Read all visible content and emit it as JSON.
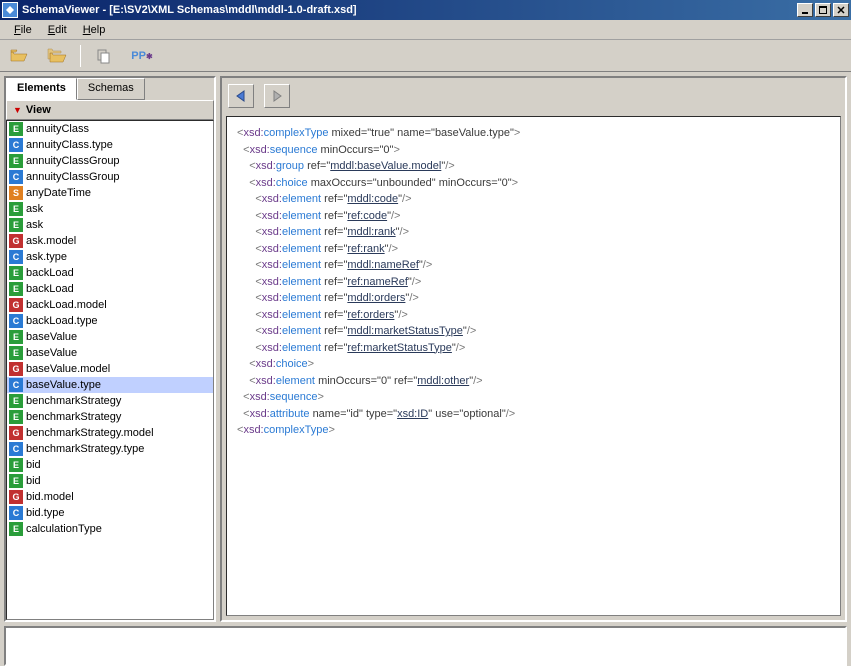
{
  "title": "SchemaViewer - [E:\\SV2\\XML Schemas\\mddl\\mddl-1.0-draft.xsd]",
  "menu": {
    "file": "File",
    "edit": "Edit",
    "help": "Help"
  },
  "tabs": {
    "elements": "Elements",
    "schemas": "Schemas"
  },
  "view_label": "View",
  "tree": [
    {
      "badge": "E",
      "label": "annuityClass"
    },
    {
      "badge": "C",
      "label": "annuityClass.type"
    },
    {
      "badge": "E",
      "label": "annuityClassGroup"
    },
    {
      "badge": "C",
      "label": "annuityClassGroup"
    },
    {
      "badge": "S",
      "label": "anyDateTime"
    },
    {
      "badge": "E",
      "label": "ask"
    },
    {
      "badge": "E",
      "label": "ask"
    },
    {
      "badge": "G",
      "label": "ask.model"
    },
    {
      "badge": "C",
      "label": "ask.type"
    },
    {
      "badge": "E",
      "label": "backLoad"
    },
    {
      "badge": "E",
      "label": "backLoad"
    },
    {
      "badge": "G",
      "label": "backLoad.model"
    },
    {
      "badge": "C",
      "label": "backLoad.type"
    },
    {
      "badge": "E",
      "label": "baseValue"
    },
    {
      "badge": "E",
      "label": "baseValue"
    },
    {
      "badge": "G",
      "label": "baseValue.model"
    },
    {
      "badge": "C",
      "label": "baseValue.type",
      "selected": true
    },
    {
      "badge": "E",
      "label": "benchmarkStrategy"
    },
    {
      "badge": "E",
      "label": "benchmarkStrategy"
    },
    {
      "badge": "G",
      "label": "benchmarkStrategy.model"
    },
    {
      "badge": "C",
      "label": "benchmarkStrategy.type"
    },
    {
      "badge": "E",
      "label": "bid"
    },
    {
      "badge": "E",
      "label": "bid"
    },
    {
      "badge": "G",
      "label": "bid.model"
    },
    {
      "badge": "C",
      "label": "bid.type"
    },
    {
      "badge": "E",
      "label": "calculationType"
    }
  ],
  "code": [
    {
      "indent": 0,
      "type": "open",
      "pfx": "xsd:",
      "tag": "complexType",
      "attrs": [
        [
          "mixed",
          "\"true\""
        ],
        [
          "name",
          "\"baseValue.type\""
        ]
      ]
    },
    {
      "indent": 1,
      "type": "open",
      "pfx": "xsd:",
      "tag": "sequence",
      "attrs": [
        [
          "minOccurs",
          "\"0\""
        ]
      ]
    },
    {
      "indent": 2,
      "type": "self",
      "pfx": "xsd:",
      "tag": "group",
      "attrs": [
        [
          "ref",
          "\"mddl:baseValue.model\"",
          "ref"
        ]
      ]
    },
    {
      "indent": 2,
      "type": "open",
      "pfx": "xsd:",
      "tag": "choice",
      "attrs": [
        [
          "maxOccurs",
          "\"unbounded\""
        ],
        [
          "minOccurs",
          "\"0\""
        ]
      ]
    },
    {
      "indent": 3,
      "type": "self",
      "pfx": "xsd:",
      "tag": "element",
      "attrs": [
        [
          "ref",
          "\"mddl:code\"",
          "ref"
        ]
      ]
    },
    {
      "indent": 3,
      "type": "self",
      "pfx": "xsd:",
      "tag": "element",
      "attrs": [
        [
          "ref",
          "\"ref:code\"",
          "ref"
        ]
      ]
    },
    {
      "indent": 3,
      "type": "self",
      "pfx": "xsd:",
      "tag": "element",
      "attrs": [
        [
          "ref",
          "\"mddl:rank\"",
          "ref"
        ]
      ]
    },
    {
      "indent": 3,
      "type": "self",
      "pfx": "xsd:",
      "tag": "element",
      "attrs": [
        [
          "ref",
          "\"ref:rank\"",
          "ref"
        ]
      ]
    },
    {
      "indent": 3,
      "type": "self",
      "pfx": "xsd:",
      "tag": "element",
      "attrs": [
        [
          "ref",
          "\"mddl:nameRef\"",
          "ref"
        ]
      ]
    },
    {
      "indent": 3,
      "type": "self",
      "pfx": "xsd:",
      "tag": "element",
      "attrs": [
        [
          "ref",
          "\"ref:nameRef\"",
          "ref"
        ]
      ]
    },
    {
      "indent": 3,
      "type": "self",
      "pfx": "xsd:",
      "tag": "element",
      "attrs": [
        [
          "ref",
          "\"mddl:orders\"",
          "ref"
        ]
      ]
    },
    {
      "indent": 3,
      "type": "self",
      "pfx": "xsd:",
      "tag": "element",
      "attrs": [
        [
          "ref",
          "\"ref:orders\"",
          "ref"
        ]
      ]
    },
    {
      "indent": 3,
      "type": "self",
      "pfx": "xsd:",
      "tag": "element",
      "attrs": [
        [
          "ref",
          "\"mddl:marketStatusType\"",
          "ref"
        ]
      ]
    },
    {
      "indent": 3,
      "type": "self",
      "pfx": "xsd:",
      "tag": "element",
      "attrs": [
        [
          "ref",
          "\"ref:marketStatusType\"",
          "ref"
        ]
      ]
    },
    {
      "indent": 2,
      "type": "close",
      "pfx": "xsd:",
      "tag": "choice"
    },
    {
      "indent": 2,
      "type": "self",
      "pfx": "xsd:",
      "tag": "element",
      "attrs": [
        [
          "minOccurs",
          "\"0\""
        ],
        [
          "ref",
          "\"mddl:other\"",
          "ref"
        ]
      ]
    },
    {
      "indent": 1,
      "type": "close",
      "pfx": "xsd:",
      "tag": "sequence"
    },
    {
      "indent": 1,
      "type": "self",
      "pfx": "xsd:",
      "tag": "attribute",
      "attrs": [
        [
          "name",
          "\"id\""
        ],
        [
          "type",
          "\"xsd:ID\"",
          "ref"
        ],
        [
          "use",
          "\"optional\""
        ]
      ]
    },
    {
      "indent": 0,
      "type": "close",
      "pfx": "xsd:",
      "tag": "complexType"
    }
  ]
}
